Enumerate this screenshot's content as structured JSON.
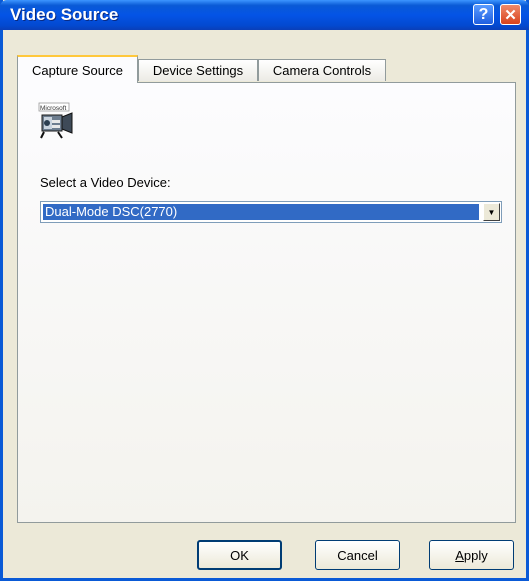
{
  "window": {
    "title": "Video Source",
    "help_glyph": "?",
    "close_glyph": "✕"
  },
  "tabs": [
    {
      "label": "Capture Source",
      "active": true
    },
    {
      "label": "Device Settings",
      "active": false
    },
    {
      "label": "Camera Controls",
      "active": false
    }
  ],
  "panel": {
    "icon": "video-camera-icon",
    "icon_text": "Microsoft",
    "device_label": "Select a Video Device:",
    "device_value": "Dual-Mode DSC(2770)"
  },
  "buttons": {
    "ok": "OK",
    "cancel": "Cancel",
    "apply": "Apply"
  },
  "colors": {
    "titlebar": "#0454e6",
    "selection": "#316ac5",
    "dialog_bg": "#ece9d8",
    "tab_highlight": "#ffc83c"
  }
}
